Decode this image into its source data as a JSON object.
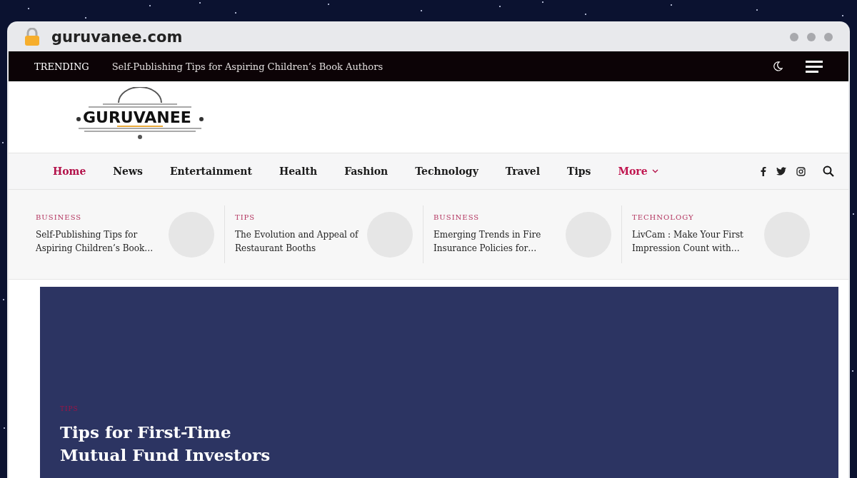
{
  "browser": {
    "url": "guruvanee.com"
  },
  "trending": {
    "label": "TRENDING",
    "headline": "Self-Publishing Tips for Aspiring Children’s Book Authors"
  },
  "logo": {
    "text": "GURUVANEE"
  },
  "nav": [
    {
      "label": "Home",
      "selected": true,
      "kind": "link"
    },
    {
      "label": "News",
      "selected": false,
      "kind": "link"
    },
    {
      "label": "Entertainment",
      "selected": false,
      "kind": "link"
    },
    {
      "label": "Health",
      "selected": false,
      "kind": "link"
    },
    {
      "label": "Fashion",
      "selected": false,
      "kind": "link"
    },
    {
      "label": "Technology",
      "selected": false,
      "kind": "link"
    },
    {
      "label": "Travel",
      "selected": false,
      "kind": "link"
    },
    {
      "label": "Tips",
      "selected": false,
      "kind": "link"
    },
    {
      "label": "More",
      "selected": false,
      "kind": "dropdown"
    }
  ],
  "featured": [
    {
      "category": "BUSINESS",
      "title": "Self-Publishing Tips for Aspiring Children’s Book…"
    },
    {
      "category": "TIPS",
      "title": "The Evolution and Appeal of Restaurant Booths"
    },
    {
      "category": "BUSINESS",
      "title": "Emerging Trends in Fire Insurance Policies for…"
    },
    {
      "category": "TECHNOLOGY",
      "title": "LivCam : Make Your First Impression Count with…"
    }
  ],
  "hero": {
    "category": "TIPS",
    "title": "Tips for First-Time Mutual Fund Investors"
  }
}
